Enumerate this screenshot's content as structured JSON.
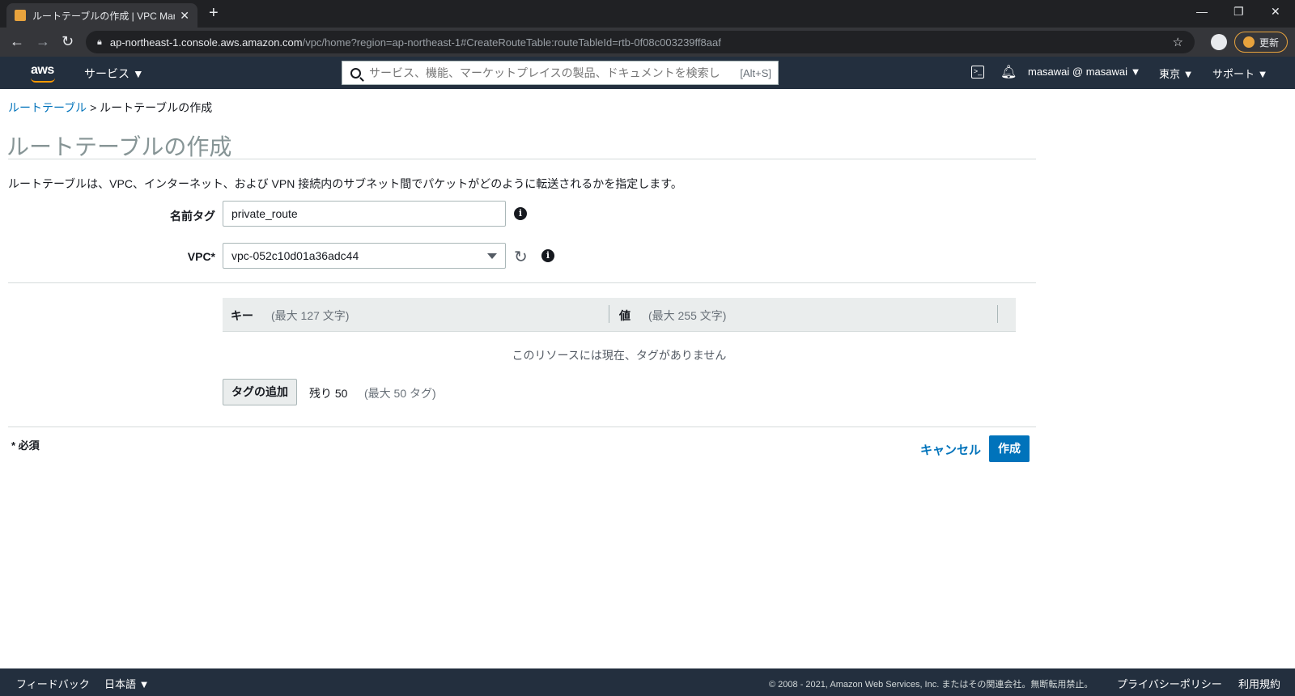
{
  "browser": {
    "tab_title": "ルートテーブルの作成 | VPC Manager",
    "url_host": "ap-northeast-1.console.aws.amazon.com",
    "url_path": "/vpc/home?region=ap-northeast-1#CreateRouteTable:routeTableId=rtb-0f08c003239ff8aaf",
    "update_label": "更新"
  },
  "awsnav": {
    "logo": "aws",
    "services_label": "サービス ▼",
    "search_placeholder": "サービス、機能、マーケットプレイスの製品、ドキュメントを検索し",
    "search_hint": "[Alt+S]",
    "account": "masawai @ masawai ▼",
    "region": "東京 ▼",
    "support": "サポート ▼"
  },
  "breadcrumb": {
    "parent": "ルートテーブル",
    "separator": ">",
    "current": "ルートテーブルの作成"
  },
  "page": {
    "title": "ルートテーブルの作成",
    "description": "ルートテーブルは、VPC、インターネット、および VPN 接続内のサブネット間でパケットがどのように転送されるかを指定します。"
  },
  "form": {
    "name_tag_label": "名前タグ",
    "name_tag_value": "private_route",
    "vpc_label": "VPC*",
    "vpc_value": "vpc-052c10d01a36adc44"
  },
  "tags": {
    "key_header": "キー",
    "key_sub": "(最大 127 文字)",
    "value_header": "値",
    "value_sub": "(最大 255 文字)",
    "empty_message": "このリソースには現在、タグがありません",
    "add_button": "タグの追加",
    "remaining": "残り 50",
    "max": "(最大 50 タグ)"
  },
  "actions": {
    "required_note": "* 必須",
    "cancel_label": "キャンセル",
    "create_label": "作成"
  },
  "footer": {
    "feedback": "フィードバック",
    "language": "日本語 ▼",
    "copyright": "© 2008 - 2021, Amazon Web Services, Inc. またはその関連会社。無断転用禁止。",
    "privacy": "プライバシーポリシー",
    "terms": "利用規約"
  },
  "colors": {
    "aws_nav": "#232f3e",
    "link": "#0073bb",
    "primary_button": "#0073bb"
  }
}
